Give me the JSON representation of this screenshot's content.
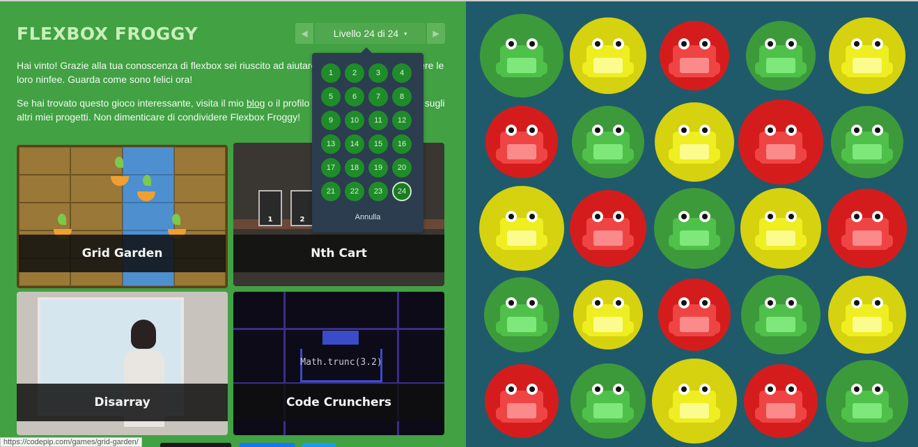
{
  "app": {
    "title": "FLEXBOX FROGGY"
  },
  "level_nav": {
    "prev_label": "◀",
    "next_label": "▶",
    "level_text": "Livello 24 di 24",
    "caret": "▾"
  },
  "instructions": {
    "p1": "Hai vinto! Grazie alla tua conoscenza di flexbox sei riuscito ad aiutare tutte le rane a raggiungere le loro ninfee. Guarda come sono felici ora!",
    "p2_before": "Se hai trovato questo gioco interessante, visita il mio ",
    "p2_link": "blog",
    "p2_after": " o il profilo Twitter per aggiornamenti sugli altri miei progetti. Non dimenticare di condividere Flexbox Froggy!"
  },
  "games": [
    {
      "name": "Grid Garden"
    },
    {
      "name": "Nth Cart",
      "cart_labels": [
        "1",
        "2"
      ]
    },
    {
      "name": "Disarray"
    },
    {
      "name": "Code Crunchers",
      "code_text": "Math.trunc(3.2)"
    }
  ],
  "dropdown": {
    "levels": [
      "1",
      "2",
      "3",
      "4",
      "5",
      "6",
      "7",
      "8",
      "9",
      "10",
      "11",
      "12",
      "13",
      "14",
      "15",
      "16",
      "17",
      "18",
      "19",
      "20",
      "21",
      "22",
      "23",
      "24"
    ],
    "current": "24",
    "cancel_label": "Annulla"
  },
  "statusbar": {
    "url": "https://codepip.com/games/grid-garden/"
  },
  "colors": {
    "green": {
      "pad": "#3d9a3a",
      "body": "#4fc04a",
      "belly": "#7ee87a"
    },
    "yellow": {
      "pad": "#d6d210",
      "body": "#eeee20",
      "belly": "#fbfb8e"
    },
    "red": {
      "pad": "#d51c1c",
      "body": "#ef4444",
      "belly": "#fb8a8a"
    }
  },
  "board": {
    "rows": [
      [
        "green",
        "yellow",
        "red",
        "green",
        "yellow"
      ],
      [
        "red",
        "green",
        "yellow",
        "red",
        "green"
      ],
      [
        "yellow",
        "red",
        "green",
        "yellow",
        "red"
      ],
      [
        "green",
        "yellow",
        "red",
        "green",
        "yellow"
      ],
      [
        "red",
        "green",
        "yellow",
        "red",
        "green"
      ]
    ]
  }
}
